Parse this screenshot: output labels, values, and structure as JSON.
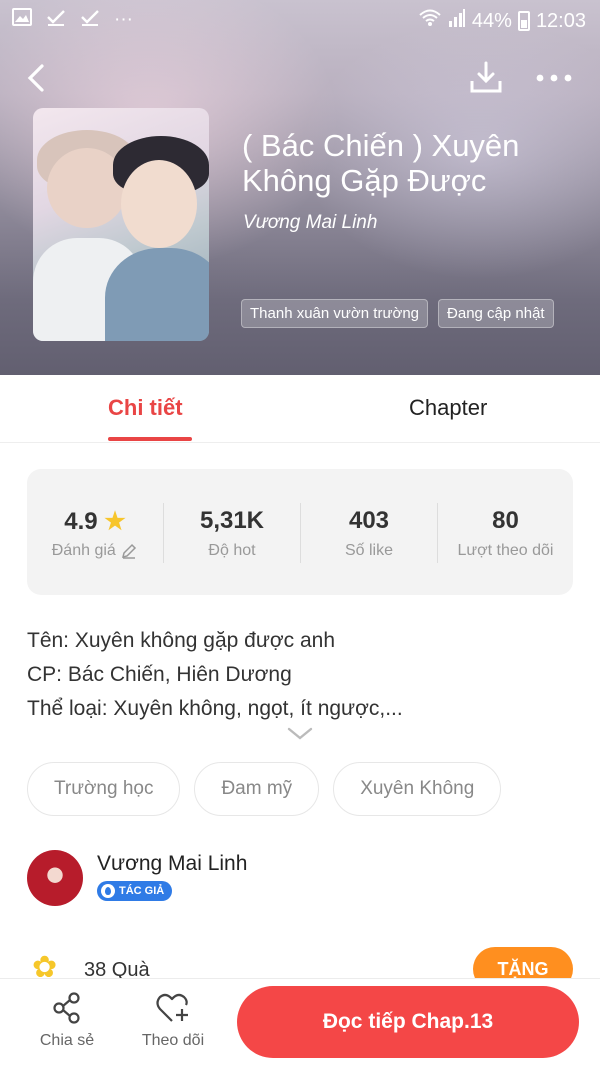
{
  "status_bar": {
    "signal_text": "44%",
    "time": "12:03"
  },
  "book": {
    "title": "( Bác Chiến ) Xuyên Không Gặp Được",
    "author": "Vương Mai Linh",
    "tags": [
      "Thanh xuân vườn trường",
      "Đang cập nhật"
    ]
  },
  "tabs": {
    "detail": "Chi tiết",
    "chapter": "Chapter"
  },
  "stats": {
    "rating": {
      "value": "4.9",
      "label": "Đánh giá"
    },
    "hot": {
      "value": "5,31K",
      "label": "Độ hot"
    },
    "likes": {
      "value": "403",
      "label": "Số like"
    },
    "follows": {
      "value": "80",
      "label": "Lượt theo dõi"
    }
  },
  "description": {
    "line1": "Tên: Xuyên không gặp được anh",
    "line2": "CP: Bác Chiến, Hiên Dương",
    "line3": "Thể loại: Xuyên không, ngọt, ít ngược,..."
  },
  "genres": [
    "Trường học",
    "Đam mỹ",
    "Xuyên Không"
  ],
  "author_section": {
    "name": "Vương Mai Linh",
    "badge": "TÁC GIẢ"
  },
  "gifts": {
    "count_text": "38 Quà",
    "button": "TẶNG"
  },
  "bottom_bar": {
    "share": "Chia sẻ",
    "follow": "Theo dõi",
    "read": "Đọc tiếp Chap.13"
  },
  "colors": {
    "accent": "#e94545",
    "read_button": "#f44747",
    "gift_button": "#ff8f1f",
    "badge": "#2f7be6",
    "star": "#f7c52b"
  }
}
